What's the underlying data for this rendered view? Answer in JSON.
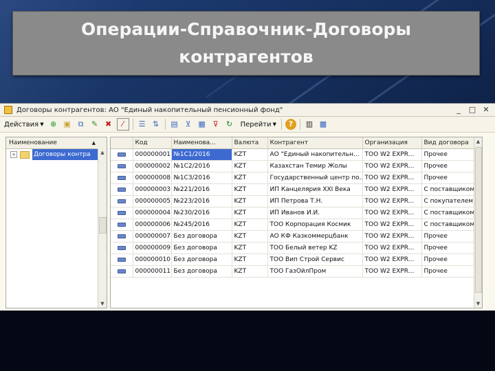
{
  "slide": {
    "title": "Операции-Справочник-Договоры контрагентов"
  },
  "window": {
    "title": "Договоры контрагентов: АО \"Единый накопительный пенсионный фонд\"",
    "controls": [
      "_",
      "□",
      "✕"
    ]
  },
  "toolbar": {
    "actions_label": "Действия",
    "goto_label": "Перейти",
    "icons": [
      "add-icon",
      "add-folder-icon",
      "copy-icon",
      "edit-icon",
      "delete-icon",
      "mark-delete-icon",
      "hierarchy-icon",
      "move-icon",
      "select-icon",
      "filter-icon",
      "filter-list-icon",
      "clear-filter-icon",
      "refresh-icon",
      "help-icon",
      "columns-icon",
      "settings-icon"
    ]
  },
  "tree": {
    "header": "Наименование",
    "items": [
      {
        "label": "Договоры контра"
      }
    ]
  },
  "grid": {
    "columns": [
      "",
      "Код",
      "Наименова...",
      "Валюта",
      "Контрагент",
      "Организация",
      "Вид договора"
    ],
    "rows": [
      {
        "code": "000000001",
        "name": "№1С1/2016",
        "currency": "KZT",
        "counterparty": "АО \"Единый накопительн...",
        "org": "ТОО W2 EXPR...",
        "type": "Прочее"
      },
      {
        "code": "000000002",
        "name": "№1С2/2016",
        "currency": "KZT",
        "counterparty": "Казахстан Темир Жолы",
        "org": "ТОО W2 EXPR...",
        "type": "Прочее"
      },
      {
        "code": "000000008",
        "name": "№1С3/2016",
        "currency": "KZT",
        "counterparty": "Государственный центр по...",
        "org": "ТОО W2 EXPR...",
        "type": "Прочее"
      },
      {
        "code": "000000003",
        "name": "№221/2016",
        "currency": "KZT",
        "counterparty": "ИП Канцелярия XXI Века",
        "org": "ТОО W2 EXPR...",
        "type": "С поставщиком"
      },
      {
        "code": "000000005",
        "name": "№223/2016",
        "currency": "KZT",
        "counterparty": "ИП Петрова Т.Н.",
        "org": "ТОО W2 EXPR...",
        "type": "С покупателем"
      },
      {
        "code": "000000004",
        "name": "№230/2016",
        "currency": "KZT",
        "counterparty": "ИП Иванов И.И.",
        "org": "ТОО W2 EXPR...",
        "type": "С поставщиком"
      },
      {
        "code": "000000006",
        "name": "№245/2016",
        "currency": "KZT",
        "counterparty": "ТОО Корпорация Космик",
        "org": "ТОО W2 EXPR...",
        "type": "С поставщиком"
      },
      {
        "code": "000000007",
        "name": "Без договора",
        "currency": "KZT",
        "counterparty": "АО КФ Казкоммерцбанк",
        "org": "ТОО W2 EXPR...",
        "type": "Прочее"
      },
      {
        "code": "000000009",
        "name": "Без договора",
        "currency": "KZT",
        "counterparty": "ТОО Белый ветер KZ",
        "org": "ТОО W2 EXPR...",
        "type": "Прочее"
      },
      {
        "code": "000000010",
        "name": "Без договора",
        "currency": "KZT",
        "counterparty": "ТОО Вип Строй Сервис",
        "org": "ТОО W2 EXPR...",
        "type": "Прочее"
      },
      {
        "code": "000000011",
        "name": "Без договора",
        "currency": "KZT",
        "counterparty": "ТОО ГазОйлПром",
        "org": "ТОО W2 EXPR...",
        "type": "Прочее"
      }
    ]
  },
  "colors": {
    "title_box": "#8a8a8a",
    "selection": "#3c6ad0",
    "window_bg": "#fbf8ee"
  }
}
